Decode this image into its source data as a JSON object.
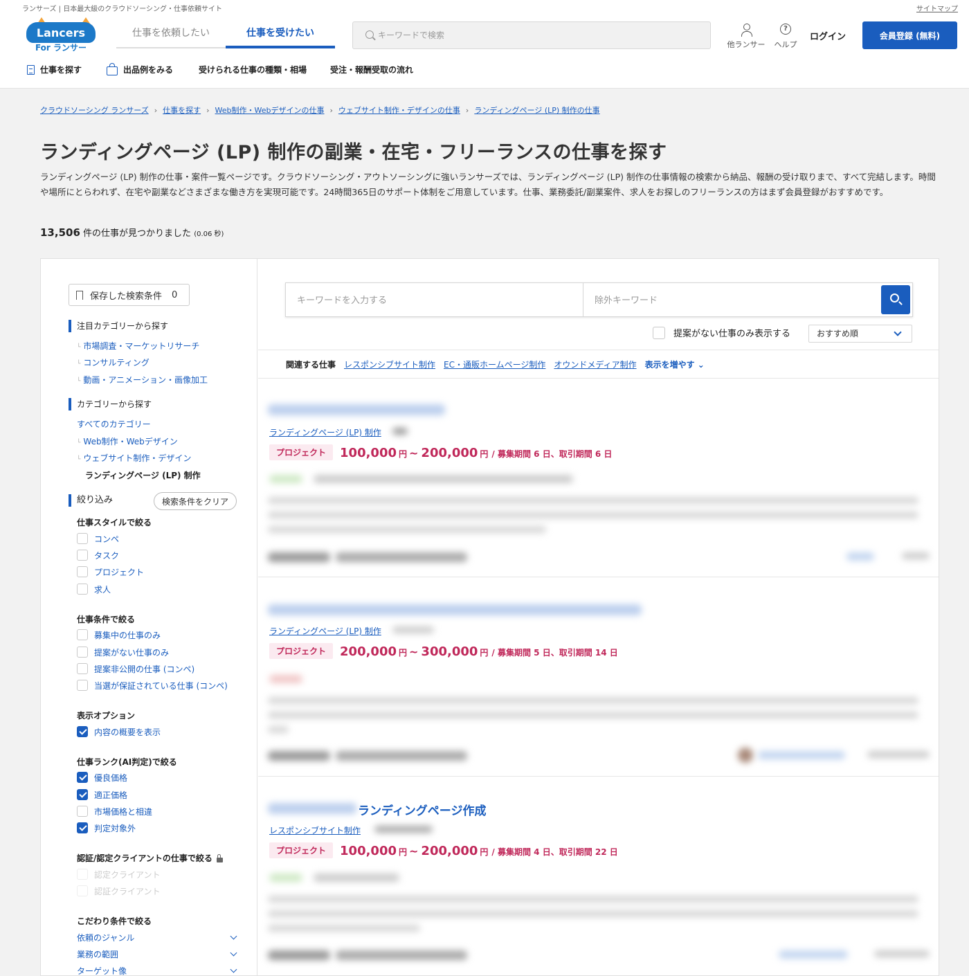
{
  "header": {
    "tagline": "ランサーズ | 日本最大級のクラウドソーシング・仕事依頼サイト",
    "sitemap": "サイトマップ",
    "logo_main": "Lancers",
    "logo_sub": "For ランサー",
    "tabs": [
      {
        "label": "仕事を依頼したい"
      },
      {
        "label": "仕事を受けたい"
      }
    ],
    "search_placeholder": "キーワードで検索",
    "other_lancer": "他ランサー",
    "help": "ヘルプ",
    "login": "ログイン",
    "signup": "会員登録 (無料)",
    "subnav": [
      {
        "label": "仕事を探す"
      },
      {
        "label": "出品例をみる"
      },
      {
        "label": "受けられる仕事の種類・相場"
      },
      {
        "label": "受注・報酬受取の流れ"
      }
    ]
  },
  "breadcrumb": [
    "クラウドソーシング ランサーズ",
    "仕事を探す",
    "Web制作・Webデザインの仕事",
    "ウェブサイト制作・デザインの仕事",
    "ランディングページ (LP) 制作の仕事"
  ],
  "page": {
    "title": "ランディングページ (LP) 制作の副業・在宅・フリーランスの仕事を探す",
    "description": "ランディングページ (LP) 制作の仕事・案件一覧ページです。クラウドソーシング・アウトソーシングに強いランサーズでは、ランディングページ (LP) 制作の仕事情報の検索から納品、報酬の受け取りまで、すべて完結します。時間や場所にとらわれず、在宅や副業などさまざまな働き方を実現可能です。24時間365日のサポート体制をご用意しています。仕事、業務委託/副業案件、求人をお探しのフリーランスの方はまず会員登録がおすすめです。",
    "count": "13,506",
    "count_suffix": "件の仕事が見つかりました",
    "time": "(0.06 秒)"
  },
  "sidebar": {
    "saved_label": "保存した検索条件",
    "saved_count": "0",
    "featured_head": "注目カテゴリーから探す",
    "featured": [
      "市場調査・マーケットリサーチ",
      "コンサルティング",
      "動画・アニメーション・画像加工"
    ],
    "category_head": "カテゴリーから探す",
    "categories": [
      "すべてのカテゴリー",
      "Web制作・Webデザイン",
      "ウェブサイト制作・デザイン"
    ],
    "current_category": "ランディングページ (LP) 制作",
    "refine_head": "絞り込み",
    "clear": "検索条件をクリア",
    "style_head": "仕事スタイルで絞る",
    "styles": [
      {
        "label": "コンペ",
        "checked": false
      },
      {
        "label": "タスク",
        "checked": false
      },
      {
        "label": "プロジェクト",
        "checked": false
      },
      {
        "label": "求人",
        "checked": false
      }
    ],
    "cond_head": "仕事条件で絞る",
    "conditions": [
      {
        "label": "募集中の仕事のみ",
        "checked": false
      },
      {
        "label": "提案がない仕事のみ",
        "checked": false
      },
      {
        "label": "提案非公開の仕事 (コンペ)",
        "checked": false
      },
      {
        "label": "当選が保証されている仕事 (コンペ)",
        "checked": false
      }
    ],
    "display_head": "表示オプション",
    "display": [
      {
        "label": "内容の概要を表示",
        "checked": true
      }
    ],
    "rank_head": "仕事ランク(AI判定)で絞る",
    "ranks": [
      {
        "label": "優良価格",
        "checked": true
      },
      {
        "label": "適正価格",
        "checked": true
      },
      {
        "label": "市場価格と相違",
        "checked": false
      },
      {
        "label": "判定対象外",
        "checked": true
      }
    ],
    "cert_head": "認証/認定クライアントの仕事で絞る",
    "certs": [
      "認定クライアント",
      "認証クライアント"
    ],
    "pref_head": "こだわり条件で絞る",
    "prefs": [
      "依頼のジャンル",
      "業務の範囲",
      "ターゲット像"
    ]
  },
  "content": {
    "keyword_placeholder": "キーワードを入力する",
    "exclude_placeholder": "除外キーワード",
    "no_proposal": "提案がない仕事のみ表示する",
    "sort": "おすすめ順",
    "related_label": "関連する仕事",
    "related": [
      "レスポンシブサイト制作",
      "EC・通販ホームページ制作",
      "オウンドメディア制作"
    ],
    "more": "表示を増やす"
  },
  "jobs": [
    {
      "title_visible": "",
      "category": "ランディングページ (LP) 制作",
      "badge": "プロジェクト",
      "price_min": "100,000",
      "price_max": "200,000",
      "unit": "円",
      "meta": "/ 募集期間 6 日、取引期間 6 日"
    },
    {
      "title_visible": "",
      "category": "ランディングページ (LP) 制作",
      "badge": "プロジェクト",
      "price_min": "200,000",
      "price_max": "300,000",
      "unit": "円",
      "meta": "/ 募集期間 5 日、取引期間 14 日"
    },
    {
      "title_visible": "ランディングページ作成",
      "category": "レスポンシブサイト制作",
      "badge": "プロジェクト",
      "price_min": "100,000",
      "price_max": "200,000",
      "unit": "円",
      "meta": "/ 募集期間 4 日、取引期間 22 日"
    }
  ],
  "colors": {
    "primary": "#1a5dbe",
    "price": "#c0285a",
    "badge_bg": "#fbeaf0",
    "background": "#f2f2f2"
  }
}
